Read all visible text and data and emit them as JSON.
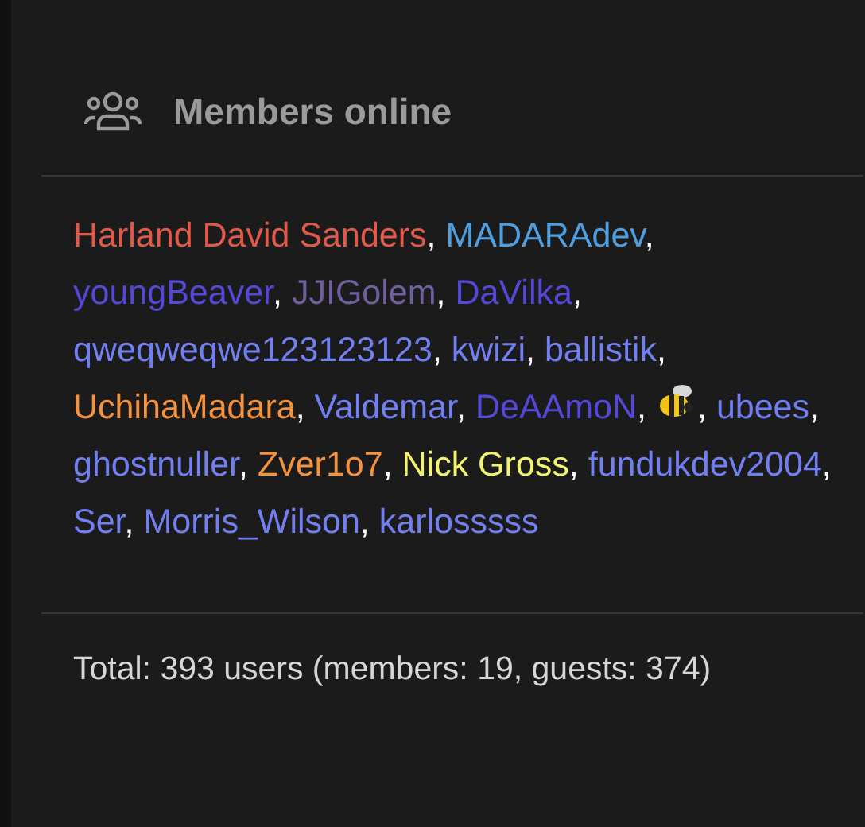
{
  "header": {
    "title": "Members online"
  },
  "separator": ", ",
  "members": [
    {
      "kind": "name",
      "name": "Harland David Sanders",
      "color": "#e0594a"
    },
    {
      "kind": "name",
      "name": "MADARAdev",
      "color": "#4e9ee0"
    },
    {
      "kind": "name",
      "name": "youngBeaver",
      "color": "#5548d9"
    },
    {
      "kind": "name",
      "name": "JJIGolem",
      "color": "#6f5f9e"
    },
    {
      "kind": "name",
      "name": "DaVilka",
      "color": "#5548d9"
    },
    {
      "kind": "name",
      "name": "qweqweqwe123123123",
      "color": "#727ff0"
    },
    {
      "kind": "name",
      "name": "kwizi",
      "color": "#727ff0"
    },
    {
      "kind": "name",
      "name": "ballistik",
      "color": "#727ff0"
    },
    {
      "kind": "name",
      "name": "UchihaMadara",
      "color": "#f5923e"
    },
    {
      "kind": "name",
      "name": "Valdemar",
      "color": "#727ff0"
    },
    {
      "kind": "name",
      "name": "DeAAmoN",
      "color": "#5548d9"
    },
    {
      "kind": "icon"
    },
    {
      "kind": "name",
      "name": "ubees",
      "color": "#727ff0"
    },
    {
      "kind": "name",
      "name": "ghostnuller",
      "color": "#727ff0"
    },
    {
      "kind": "name",
      "name": "Zver1o7",
      "color": "#f5923e"
    },
    {
      "kind": "name",
      "name": "Nick Gross",
      "color": "#f3f36e"
    },
    {
      "kind": "name",
      "name": "fundukdev2004",
      "color": "#727ff0"
    },
    {
      "kind": "name",
      "name": "Ser",
      "color": "#727ff0"
    },
    {
      "kind": "name",
      "name": "Morris_Wilson",
      "color": "#727ff0"
    },
    {
      "kind": "name",
      "name": "karlosssss",
      "color": "#727ff0"
    }
  ],
  "total": "Total: 393 users (members: 19, guests: 374)"
}
